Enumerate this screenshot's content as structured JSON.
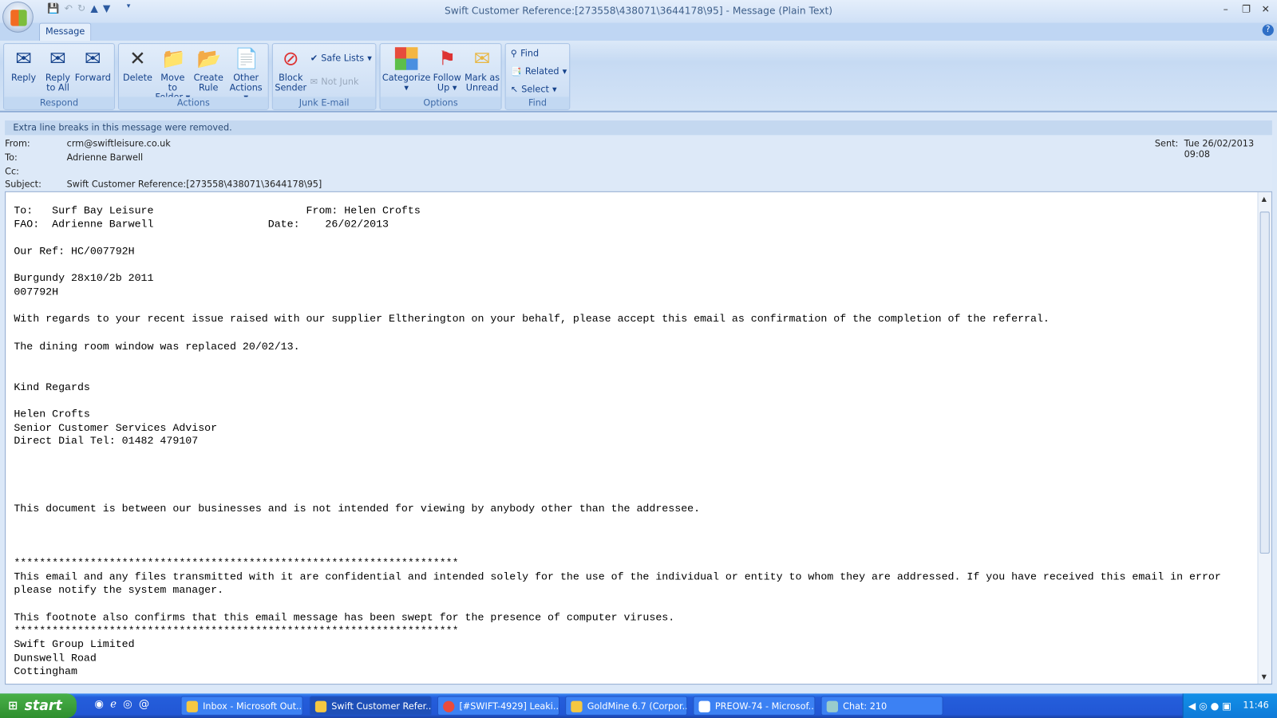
{
  "window": {
    "title": "Swift Customer Reference:[273558\\438071\\3644178\\95] - Message (Plain Text)"
  },
  "ribbon": {
    "tab": "Message",
    "groups": {
      "respond": "Respond",
      "actions": "Actions",
      "junk": "Junk E-mail",
      "options": "Options",
      "find": "Find"
    },
    "buttons": {
      "reply": "Reply",
      "reply_all": "Reply to All",
      "forward": "Forward",
      "delete": "Delete",
      "move": "Move to Folder",
      "create_rule": "Create Rule",
      "other": "Other Actions",
      "block": "Block Sender",
      "safe_lists": "Safe Lists",
      "not_junk": "Not Junk",
      "categorize": "Categorize",
      "follow_up": "Follow Up",
      "mark_unread": "Mark as Unread",
      "find": "Find",
      "related": "Related",
      "select": "Select"
    }
  },
  "info_bar": "Extra line breaks in this message were removed.",
  "header": {
    "from_label": "From:",
    "from": "crm@swiftleisure.co.uk",
    "to_label": "To:",
    "to": "Adrienne Barwell",
    "cc_label": "Cc:",
    "subject_label": "Subject:",
    "subject": "Swift Customer Reference:[273558\\438071\\3644178\\95]",
    "sent_label": "Sent:",
    "sent": "Tue 26/02/2013 09:08"
  },
  "body": "To:   Surf Bay Leisure                        From: Helen Crofts\nFAO:  Adrienne Barwell                  Date:    26/02/2013\n\nOur Ref: HC/007792H\n\nBurgundy 28x10/2b 2011\n007792H\n\nWith regards to your recent issue raised with our supplier Eltherington on your behalf, please accept this email as confirmation of the completion of the referral.\n\nThe dining room window was replaced 20/02/13.\n\n\nKind Regards\n\nHelen Crofts\nSenior Customer Services Advisor\nDirect Dial Tel: 01482 479107\n\n\n\n\nThis document is between our businesses and is not intended for viewing by anybody other than the addressee.\n\n\n\n**********************************************************************\nThis email and any files transmitted with it are confidential and intended solely for the use of the individual or entity to whom they are addressed. If you have received this email in error\nplease notify the system manager.\n\nThis footnote also confirms that this email message has been swept for the presence of computer viruses.\n**********************************************************************\nSwift Group Limited\nDunswell Road\nCottingham",
  "taskbar": {
    "start": "start",
    "tasks": [
      "Inbox - Microsoft Out...",
      "Swift Customer Refer...",
      "[#SWIFT-4929] Leaki...",
      "GoldMine 6.7 (Corpor...",
      "PREOW-74 - Microsof...",
      "Chat: 210"
    ],
    "clock": "11:46"
  }
}
